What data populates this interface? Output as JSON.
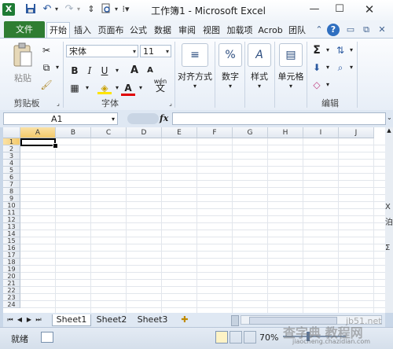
{
  "window": {
    "title": "工作簿1 - Microsoft Excel",
    "app_icon": "excel-x-icon"
  },
  "quick_access": {
    "save_icon": "save-icon",
    "undo_icon": "undo-icon",
    "redo_icon": "redo-icon",
    "print_preview_icon": "print-preview-icon",
    "customize_icon": "customize-icon"
  },
  "ribbon_tabs": [
    "文件",
    "开始",
    "插入",
    "页面布",
    "公式",
    "数据",
    "审阅",
    "视图",
    "加载项",
    "Acrob",
    "团队"
  ],
  "active_tab": "开始",
  "groups": {
    "clipboard": {
      "name": "剪贴板",
      "paste_label": "粘贴"
    },
    "font": {
      "name": "字体",
      "font_family": "宋体",
      "font_size": "11",
      "bold": "B",
      "italic": "I",
      "underline": "U",
      "font_color_letter": "A",
      "grow": "A",
      "shrink": "A",
      "wen": "wén",
      "wen_char": "文"
    },
    "alignment": {
      "label": "对齐方式"
    },
    "number": {
      "label": "数字",
      "symbol": "%"
    },
    "styles": {
      "label": "样式"
    },
    "cells": {
      "label": "单元格"
    },
    "editing": {
      "name": "编辑",
      "sum": "Σ"
    }
  },
  "formula_bar": {
    "name_box": "A1",
    "fx": "fx",
    "value": ""
  },
  "columns": [
    "A",
    "B",
    "C",
    "D",
    "E",
    "F",
    "G",
    "H",
    "I",
    "J"
  ],
  "rows": [
    "1",
    "2",
    "3",
    "4",
    "5",
    "6",
    "7",
    "8",
    "9",
    "10",
    "11",
    "12",
    "13",
    "14",
    "15",
    "16",
    "17",
    "18",
    "19",
    "20",
    "21",
    "22",
    "23",
    "24"
  ],
  "sheets": [
    "Sheet1",
    "Sheet2",
    "Sheet3"
  ],
  "active_sheet": "Sheet1",
  "status": {
    "ready": "就绪",
    "zoom": "70%"
  },
  "side_fragments": [
    "X",
    "泊",
    "Σ"
  ],
  "watermark": {
    "line1": "查字典 教程网",
    "line2": "jiaocheng.chazidian.com",
    "site": "jb51.net"
  },
  "colors": {
    "file_tab": "#2f7d32",
    "selection": "#000000",
    "ribbon_bg": "#f3f6fb",
    "header_bg": "#e3e9f1"
  }
}
